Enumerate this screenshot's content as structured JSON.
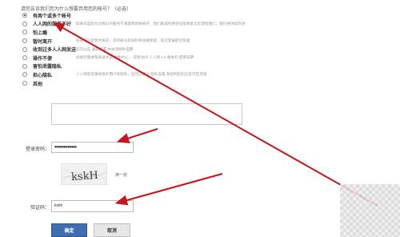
{
  "question": "请您告诉我们您为什么想要弃用您的帐号？（必选）",
  "options": [
    {
      "label": "有两个或多个帐号",
      "desc": "",
      "checked": true
    },
    {
      "label": "人人网的服务不好",
      "desc": "如果您是因为对我们的服务不满意而想要离开，我们真诚地希望您能将意见反馈给我们，我们将持续改进",
      "checked": false
    },
    {
      "label": "怕上瘾",
      "desc": "",
      "checked": false
    },
    {
      "label": "暂时离开",
      "desc": "如果您只是暂时离开，您的帐号和资料将会被保留，再次登录即可恢复",
      "checked": false
    },
    {
      "label": "收到过多人人网发送的邮件",
      "desc": "您可以在 通知设置 中关闭邮件提醒",
      "checked": false
    },
    {
      "label": "操作不便",
      "desc": "如果您需要帮助请点击 帮助中心 ，或者访问 人人网 1.0 版本的 使用说明",
      "checked": false
    },
    {
      "label": "害怕泄露隐私",
      "desc": "",
      "checked": false
    },
    {
      "label": "担心隐私",
      "desc": "人人网非常重视保护用户的隐私，您可以通过 隐私设置 来控制您的信息可见范围",
      "checked": false
    },
    {
      "label": "其他",
      "desc": "",
      "checked": false
    }
  ],
  "password": {
    "label": "登录密码：",
    "value": "••••••••••••"
  },
  "captcha": {
    "text": "kskH",
    "refresh_label": "换一张"
  },
  "verify_code": {
    "label": "验证码：",
    "value": "kskh"
  },
  "buttons": {
    "confirm": "确定",
    "cancel": "取消"
  },
  "colors": {
    "arrow": "#c4161c",
    "primary_button": "#3f6db2"
  }
}
